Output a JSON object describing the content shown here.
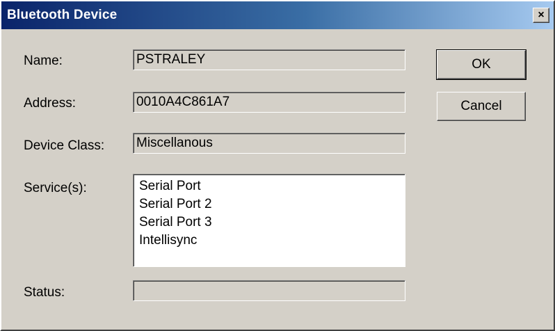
{
  "window": {
    "title": "Bluetooth Device",
    "close_glyph": "×"
  },
  "fields": {
    "name_label": "Name:",
    "name_value": "PSTRALEY",
    "address_label": "Address:",
    "address_value": "0010A4C861A7",
    "device_class_label": "Device Class:",
    "device_class_value": "Miscellanous",
    "services_label": "Service(s):",
    "services": [
      "Serial Port",
      "Serial Port 2",
      "Serial Port 3",
      "Intellisync"
    ],
    "status_label": "Status:",
    "status_value": ""
  },
  "buttons": {
    "ok_label": "OK",
    "cancel_label": "Cancel"
  }
}
